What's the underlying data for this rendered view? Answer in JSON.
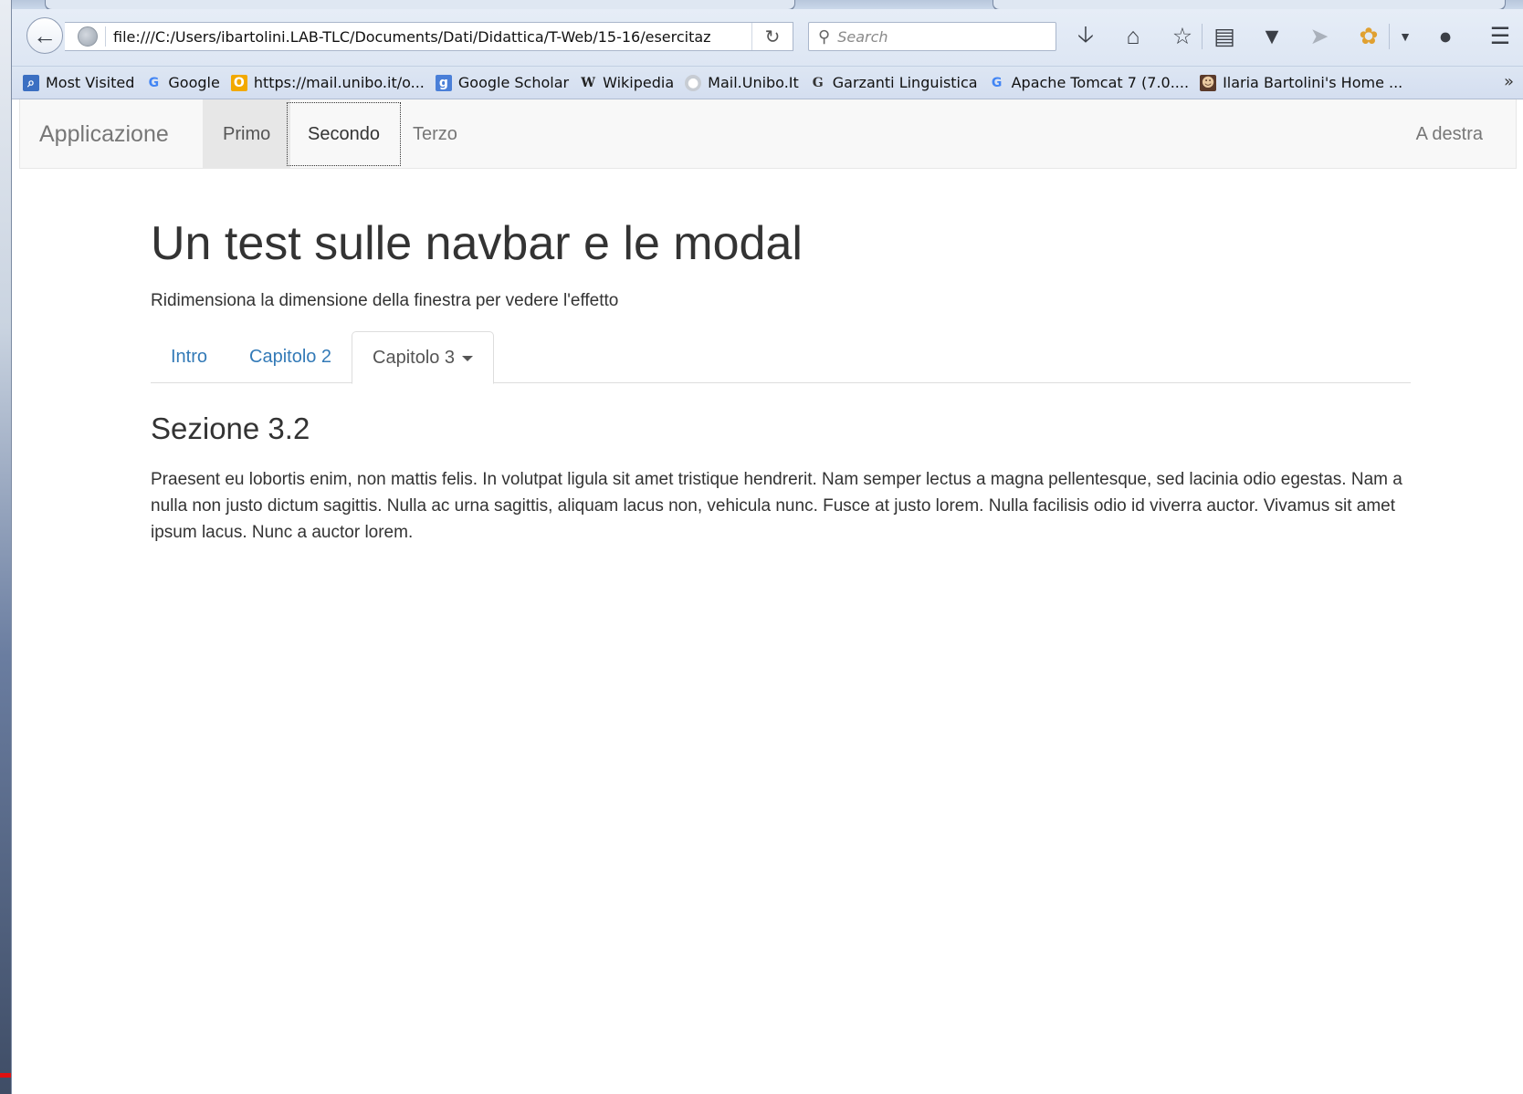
{
  "browser": {
    "url": "file:///C:/Users/ibartolini.LAB-TLC/Documents/Dati/Didattica/T-Web/15-16/esercitaz",
    "search_placeholder": "Search",
    "bookmarks": [
      {
        "label": "Most Visited",
        "icon": "most-visited-icon"
      },
      {
        "label": "Google",
        "icon": "google-icon"
      },
      {
        "label": "https://mail.unibo.it/o...",
        "icon": "outlook-icon"
      },
      {
        "label": "Google Scholar",
        "icon": "scholar-icon"
      },
      {
        "label": "Wikipedia",
        "icon": "wikipedia-icon"
      },
      {
        "label": "Mail.Unibo.It",
        "icon": "globe-icon"
      },
      {
        "label": "Garzanti Linguistica",
        "icon": "garzanti-icon"
      },
      {
        "label": "Apache Tomcat 7 (7.0....",
        "icon": "google-icon"
      },
      {
        "label": "Ilaria Bartolini's Home ...",
        "icon": "portrait-icon"
      }
    ],
    "bookmarks_more": "»"
  },
  "navbar": {
    "brand": "Applicazione",
    "links": [
      "Primo",
      "Secondo",
      "Terzo"
    ],
    "right_link": "A destra"
  },
  "page": {
    "title": "Un test sulle navbar e le modal",
    "lead": "Ridimensiona la dimensione della finestra per vedere l'effetto",
    "tabs": [
      "Intro",
      "Capitolo 2",
      "Capitolo 3"
    ],
    "section_title": "Sezione 3.2",
    "paragraph": "Praesent eu lobortis enim, non mattis felis. In volutpat ligula sit amet tristique hendrerit. Nam semper lectus a magna pellentesque, sed lacinia odio egestas. Nam a nulla non justo dictum sagittis. Nulla ac urna sagittis, aliquam lacus non, vehicula nunc. Fusce at justo lorem. Nulla facilisis odio id viverra auctor. Vivamus sit amet ipsum lacus. Nunc a auctor lorem."
  },
  "colors": {
    "link": "#337ab7",
    "navbar_bg": "#f8f8f8",
    "navbar_active": "#e7e7e7",
    "text": "#333333"
  }
}
